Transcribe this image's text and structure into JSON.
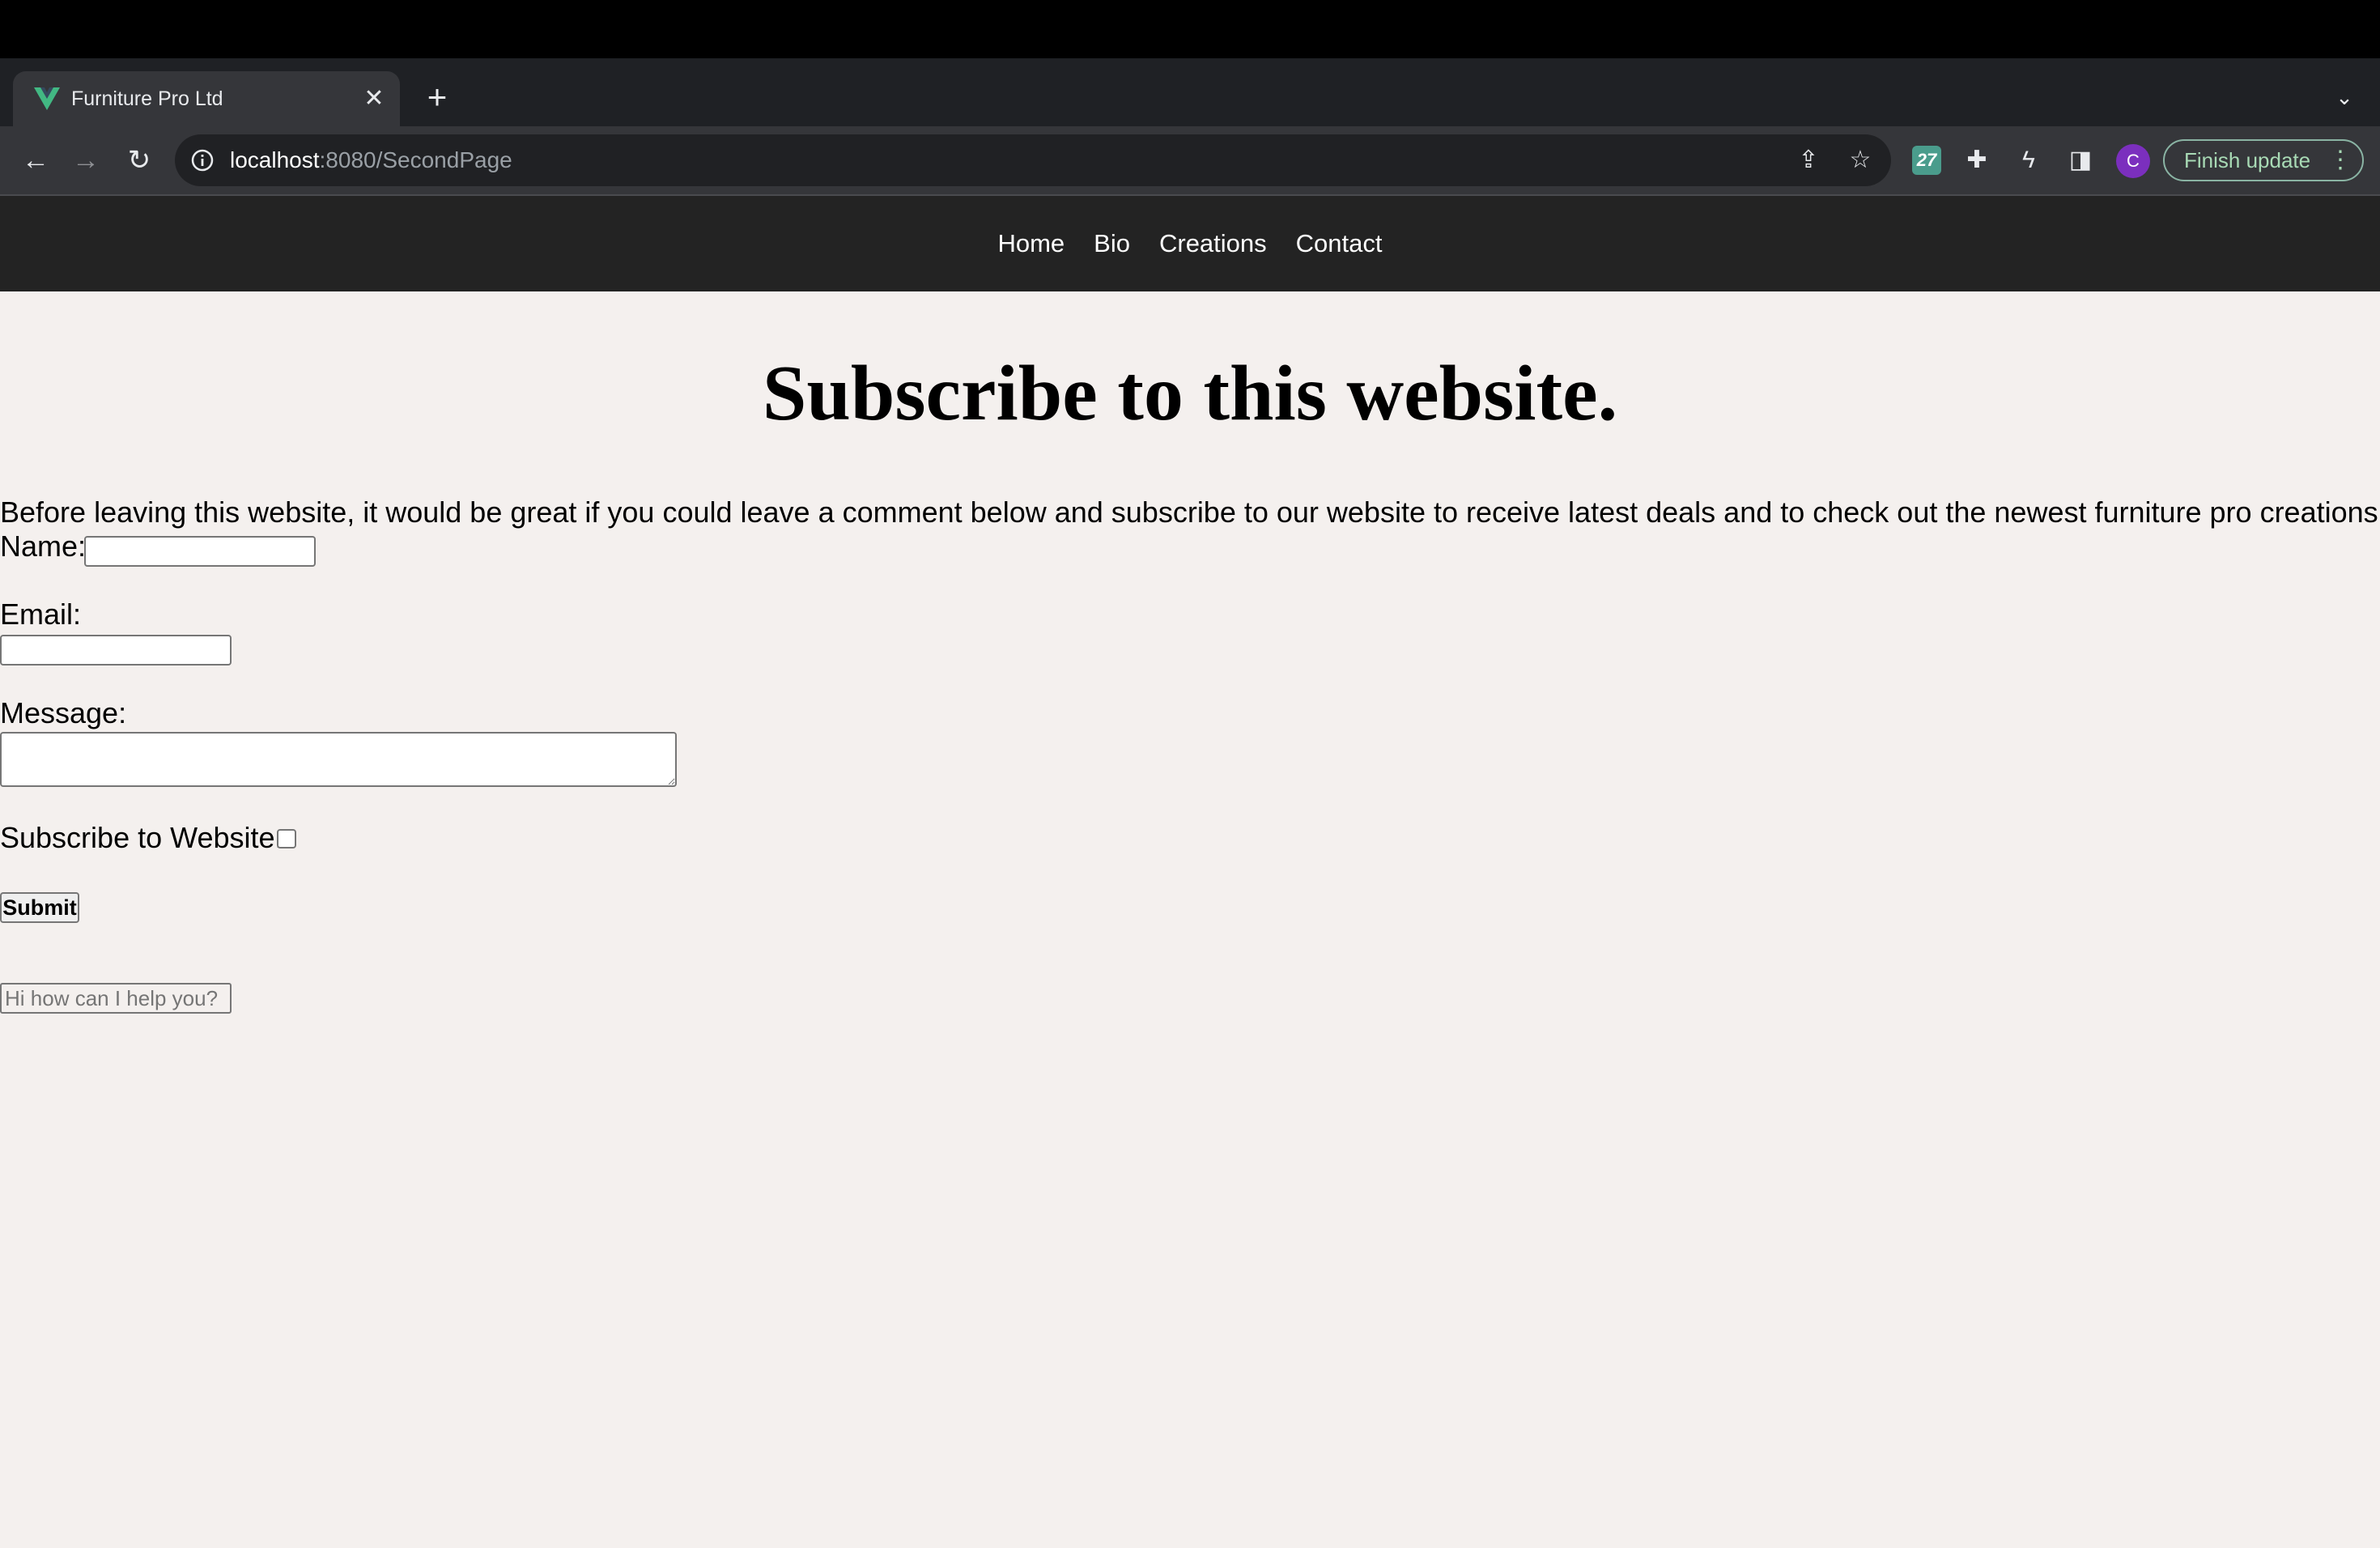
{
  "browser": {
    "tab_title": "Furniture Pro Ltd",
    "url_host": "localhost",
    "url_path": ":8080/SecondPage",
    "avatar_letter": "C",
    "finish_update_label": "Finish update",
    "extension_badge": "27"
  },
  "nav": {
    "items": [
      "Home",
      "Bio",
      "Creations",
      "Contact"
    ]
  },
  "page": {
    "heading": "Subscribe to this website.",
    "intro": "Before leaving this website, it would be great if you could leave a comment below and subscribe to our website to receive latest deals and to check out the newest furniture pro creations"
  },
  "form": {
    "name_label": "Name:",
    "email_label": "Email:",
    "message_label": "Message:",
    "subscribe_label": "Subscribe to Website:",
    "submit_label": "Submit",
    "chat_placeholder": "Hi how can I help you?"
  }
}
